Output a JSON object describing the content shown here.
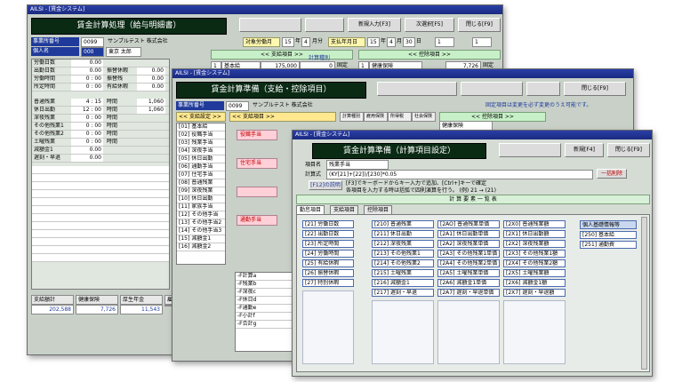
{
  "win1": {
    "titlebar": "AILSI - [賃金システム]",
    "heading": "賃金計算処理（給与明細書）",
    "btn_new": "新規入力[F3]",
    "btn_next": "次選択[F5]",
    "btn_close": "閉じる[F9]",
    "office_label": "事業所番号",
    "office_code": "0099",
    "office_name": "サンプルテスト 株式会社",
    "person_label": "個人名",
    "person_code": "000",
    "person_name": "東京 太郎",
    "period_label": "対象労働月",
    "period_year": "15",
    "period_month": "4",
    "period_suffix": "月分",
    "pay_label": "支払年月日",
    "pay_year": "15",
    "pay_month": "4",
    "pay_day": "30",
    "pay_day_suffix": "日",
    "pay_label_month": "月",
    "pay_label_year": "年",
    "sel1": "1",
    "sel2": "1",
    "sec_pay": "<< 支給項目 >>",
    "sec_deduct": "<< 控除項目 >>",
    "pay_row": {
      "no": "1",
      "item": "基本給",
      "amount": "175,000",
      "zero": "0",
      "flag": "固定"
    },
    "deduct_row": {
      "no": "1",
      "item": "健康保険",
      "amount": "7,726",
      "flag": "固定"
    },
    "sub_label": "計算種別",
    "work_rows": [
      {
        "label": "労働日数",
        "value": "0.00",
        "label2": "",
        "value2": ""
      },
      {
        "label": "出勤日数",
        "value": "0.00",
        "label2": "振替休暇",
        "value2": "0.00"
      },
      {
        "label": "労働時間",
        "value": "0 : 00",
        "label2": "振替残",
        "value2": "0.00"
      },
      {
        "label": "所定時間",
        "value": "0 : 00",
        "label2": "有給休暇",
        "value2": "0.00"
      }
    ],
    "ot_rows": [
      {
        "label": "普通残業",
        "value": "4 : 15",
        "label2": "時間",
        "value2": "1,060"
      },
      {
        "label": "休日出勤",
        "value": "12 : 00",
        "label2": "時間",
        "value2": "1,060"
      },
      {
        "label": "深夜残業",
        "value": "0 : 00",
        "label2": "時間",
        "value2": ""
      },
      {
        "label": "その他残業1",
        "value": "0 : 00",
        "label2": "時間",
        "value2": ""
      },
      {
        "label": "その他残業2",
        "value": "0 : 00",
        "label2": "時間",
        "value2": ""
      },
      {
        "label": "土曜残業",
        "value": "0 : 00",
        "label2": "時間",
        "value2": ""
      },
      {
        "label": "減額金1",
        "value": "0.00",
        "label2": "",
        "value2": ""
      },
      {
        "label": "遅刻・早退",
        "value": "0.00",
        "label2": "",
        "value2": ""
      }
    ],
    "bottom_headers": [
      "支給額計",
      "健康保険",
      "厚生年金",
      "雇用保険"
    ],
    "bottom_values": [
      "202,588",
      "7,726",
      "11,543",
      ""
    ]
  },
  "win2": {
    "titlebar": "AILSI - [賃金システム]",
    "heading": "賃金計算準備（支給・控除項目）",
    "office_label": "事業所番号",
    "office_code": "0099",
    "office_name": "サンプルテスト 株式会社",
    "btn_close": "閉じる[F9]",
    "note": "固定項目は変更を必ず変更のうえ可能です。",
    "sec_settings": "<< 支給設定 >>",
    "sec_pay": "<< 支給項目 >>",
    "sec_deduct": "<< 控除項目 >>",
    "col_heads": [
      "計算種別",
      "雇用保険",
      "所得税",
      "社会保険"
    ],
    "deduct_first": "健康保険",
    "settings": [
      {
        "code": "[01]",
        "name": "基本給"
      },
      {
        "code": "[02]",
        "name": "役職手当"
      },
      {
        "code": "[03]",
        "name": "残業手当"
      },
      {
        "code": "[04]",
        "name": "深夜手当"
      },
      {
        "code": "[05]",
        "name": "休日出勤"
      },
      {
        "code": "[06]",
        "name": "通勤手当"
      },
      {
        "code": "[07]",
        "name": "住宅手当"
      },
      {
        "code": "[08]",
        "name": "普通残業"
      },
      {
        "code": "[09]",
        "name": "深夜残業"
      },
      {
        "code": "[10]",
        "name": "休日出勤"
      },
      {
        "code": "[11]",
        "name": "家族手当"
      },
      {
        "code": "[12]",
        "name": "その他手当"
      },
      {
        "code": "[13]",
        "name": "その他手当2"
      },
      {
        "code": "[14]",
        "name": "その他手当3"
      },
      {
        "code": "[15]",
        "name": "減額金1"
      },
      {
        "code": "[16]",
        "name": "減額金2"
      }
    ],
    "pay_items": [
      "役職手当",
      "住宅手当",
      "",
      "通勤手当"
    ],
    "formulas": [
      "-F計算a",
      "-F残業b",
      "-F深夜c",
      "-F休日d",
      "-F通勤e",
      "-F小計f",
      "-F合計g"
    ]
  },
  "win3": {
    "titlebar": "AILSI - [賃金システム]",
    "heading": "賃金計算準備（計算項目設定）",
    "btn_new": "新規[F4]",
    "btn_close": "閉じる[F9]",
    "item_label": "項目名",
    "item_value": "残業手当",
    "formula_label": "計算式",
    "formula_value": "(KY[21]+[22])/[230]*0.05",
    "btn_clear": "一括削除",
    "help_btn": "[F12]の説明",
    "help1": "[F3]でキーボードからキー入力で追加、[Ctrl+]キーで確定",
    "help2": "各項目を入力する時は括弧で四則演算を行う。 (例) 21 → (21)",
    "list_title": "計 算 要 素 一 覧 表",
    "tabs": [
      "勤怠項目",
      "支給項目",
      "控除項目"
    ],
    "side_header": "個人基礎情報等",
    "side_items": [
      "[250] 基本給",
      "[251] 通勤費"
    ],
    "cols": [
      [
        "[21] 労働日数",
        "[22] 出勤日数",
        "[23] 所定時間",
        "[24] 労働時間",
        "[25] 有給休暇",
        "[26] 振替休暇",
        "[27] 特別休暇"
      ],
      [
        "[210] 普通残業",
        "[211] 休日出勤",
        "[212] 深夜残業",
        "[213] その他残業1",
        "[214] その他残業2",
        "[215] 土曜残業",
        "[216] 減額金1",
        "[217] 遅刻・早退"
      ],
      [
        "[2AO] 普通残業単価",
        "[2A1] 休日出勤単価",
        "[2A2] 深夜残業単価",
        "[2A3] その他残業1単価",
        "[2A4] その他残業2単価",
        "[2A5] 土曜残業単価",
        "[2A6] 減額金1単価",
        "[2A7] 遅刻・早退単価"
      ],
      [
        "[2X0] 普通残業額",
        "[2X1] 休日出勤額",
        "[2X2] 深夜残業額",
        "[2X3] その他残業1額",
        "[2X4] その他残業2額",
        "[2X5] 土曜残業額",
        "[2X6] 減額金1額",
        "[2X7] 遅刻・早退額"
      ]
    ]
  }
}
